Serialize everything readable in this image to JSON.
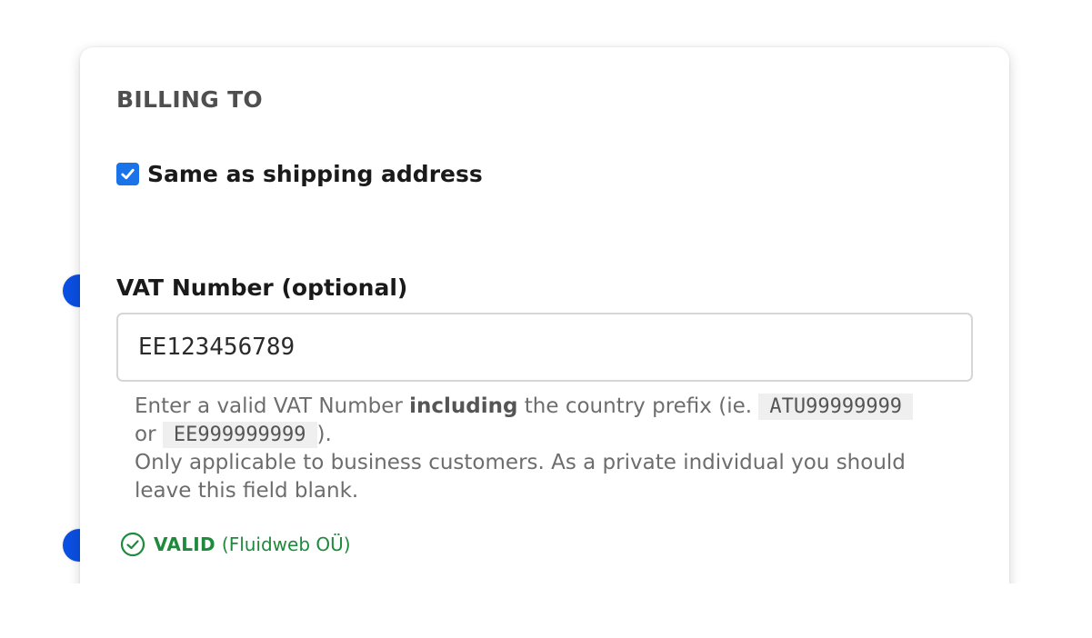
{
  "billing": {
    "title": "BILLING TO",
    "same_as_shipping": {
      "label": "Same as shipping address",
      "checked": true
    }
  },
  "vat": {
    "label": "VAT Number (optional)",
    "value": "EE123456789",
    "help": {
      "part1": "Enter a valid VAT Number ",
      "emphasis": "including",
      "part2": " the country prefix (ie. ",
      "example1": "ATU99999999",
      "or": " or ",
      "example2": "EE999999999",
      "part3": ").",
      "line2": "Only applicable to business customers. As a private individual you should leave this field blank."
    },
    "status": {
      "label": "VALID",
      "company": "(Fluidweb OÜ)"
    }
  },
  "icons": {
    "checkbox": "checkmark-icon",
    "status": "check-circle-icon"
  },
  "colors": {
    "checkbox": "#1a73e8",
    "valid": "#1e8a3c",
    "marker": "#0b4fe0",
    "code_bg": "#efefef"
  }
}
